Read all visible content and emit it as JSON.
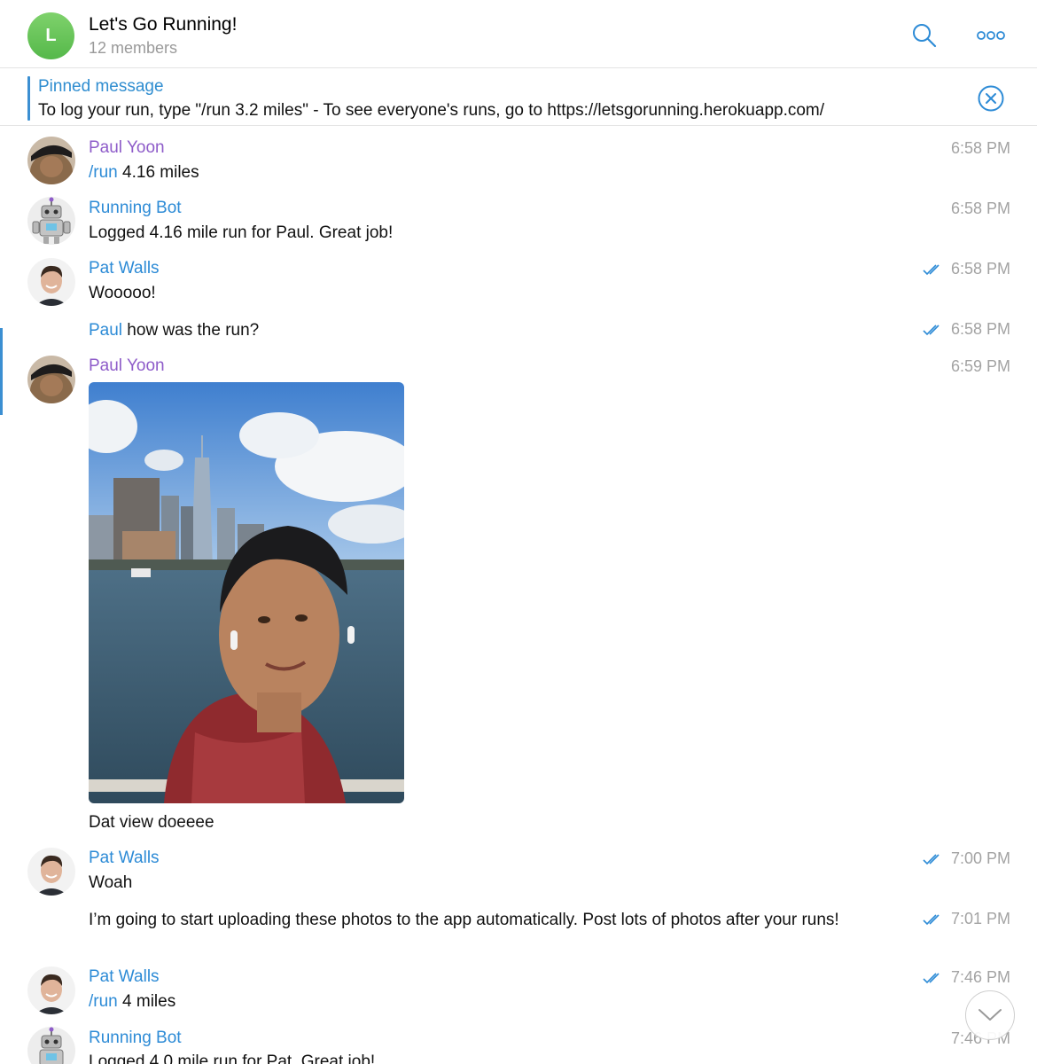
{
  "header": {
    "avatar_letter": "L",
    "title": "Let's Go Running!",
    "subtitle": "12 members",
    "search_icon": "search-icon",
    "more_icon": "more-icon"
  },
  "pinned": {
    "title": "Pinned message",
    "text": "To log your run, type \"/run 3.2 miles\" - To see everyone's runs, go to https://letsgorunning.herokuapp.com/",
    "close_icon": "close-circle-icon"
  },
  "messages": [
    {
      "sender": "Paul Yoon",
      "command": "/run",
      "text": " 4.16 miles",
      "time": "6:58 PM"
    },
    {
      "sender": "Running Bot",
      "text": "Logged 4.16 mile run for Paul. Great job!",
      "time": "6:58 PM"
    },
    {
      "sender": "Pat Walls",
      "text": "Wooooo!",
      "time": "6:58 PM"
    },
    {
      "mention": "Paul",
      "text": " how was the run?",
      "time": "6:58 PM"
    },
    {
      "sender": "Paul Yoon",
      "caption": "Dat view doeeee",
      "time": "6:59 PM"
    },
    {
      "sender": "Pat Walls",
      "text": "Woah",
      "time": "7:00 PM"
    },
    {
      "text": "I’m going to start uploading these photos to the app automatically. Post lots of photos after your runs!",
      "time": "7:01 PM"
    },
    {
      "sender": "Pat Walls",
      "command": "/run",
      "text": " 4 miles",
      "time": "7:46 PM"
    },
    {
      "sender": "Running Bot",
      "text": "Logged 4.0 mile run for Pat. Great job!",
      "time": "7:46 PM"
    }
  ],
  "colors": {
    "accent": "#2d8bd6",
    "purple_name": "#8e5cc9",
    "timestamp": "#a3a3a3"
  }
}
